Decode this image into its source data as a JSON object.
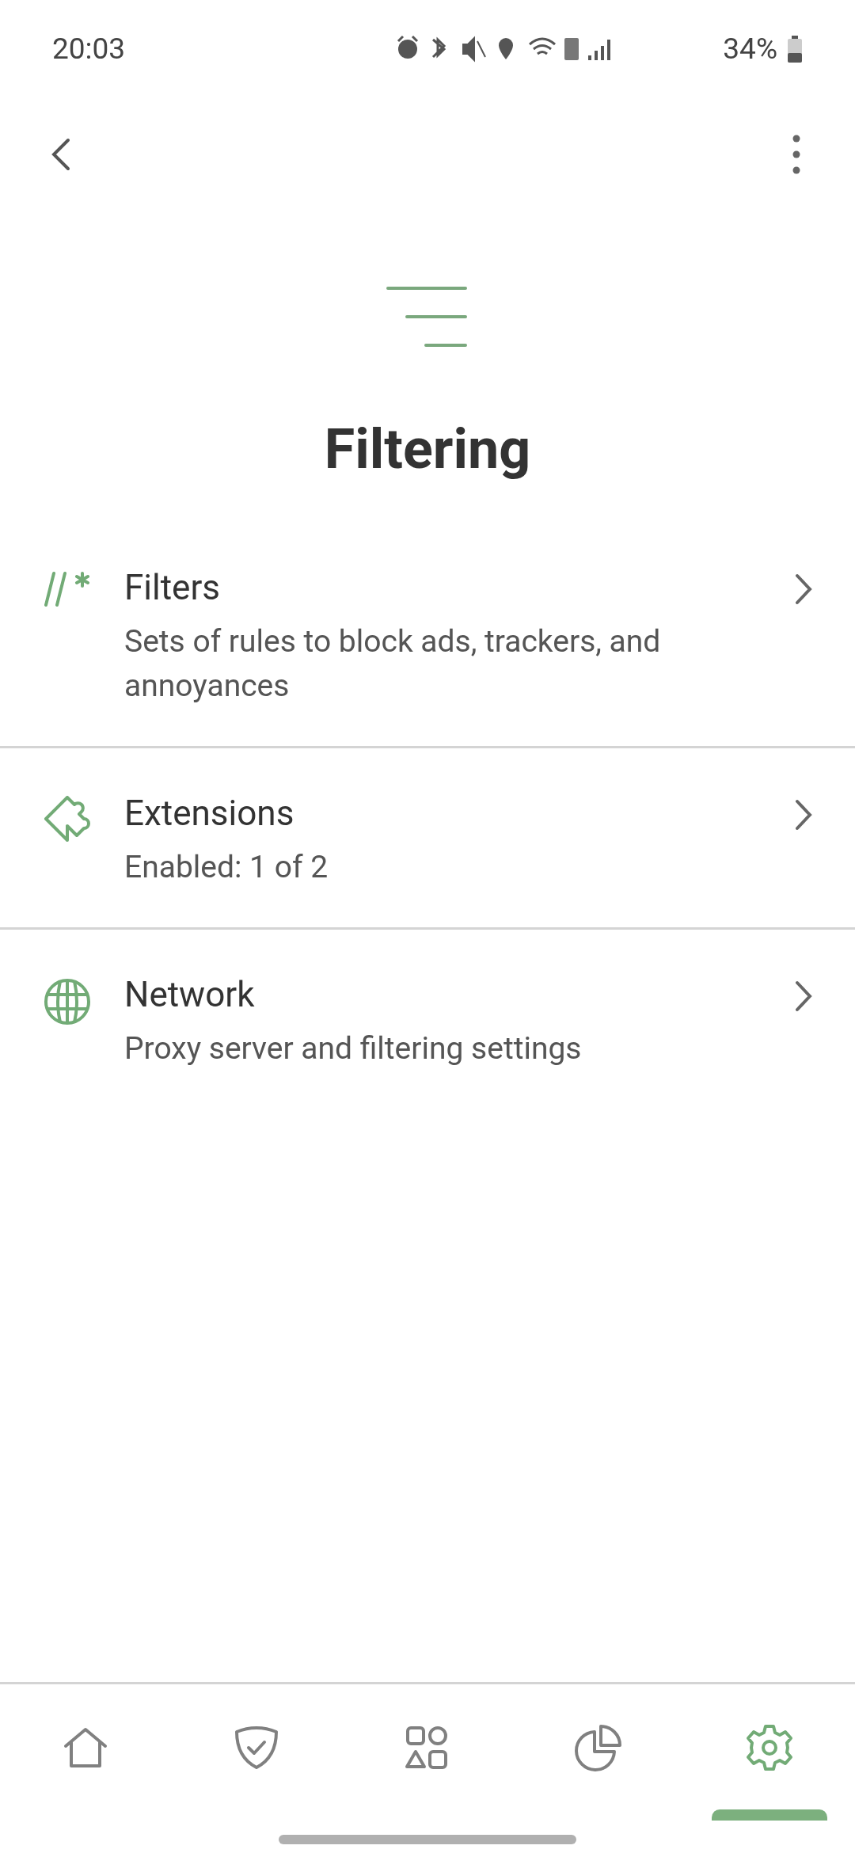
{
  "status_bar": {
    "time": "20:03",
    "battery": "34%"
  },
  "title": "Filtering",
  "items": [
    {
      "kind": "filters",
      "title": "Filters",
      "subtitle": "Sets of rules to block ads, trackers, and annoyances"
    },
    {
      "kind": "extensions",
      "title": "Extensions",
      "subtitle": "Enabled: 1 of 2"
    },
    {
      "kind": "network",
      "title": "Network",
      "subtitle": "Proxy server and filtering settings"
    }
  ],
  "nav": [
    {
      "kind": "home",
      "selected": false
    },
    {
      "kind": "protection",
      "selected": false
    },
    {
      "kind": "apps",
      "selected": false
    },
    {
      "kind": "stats",
      "selected": false
    },
    {
      "kind": "settings",
      "selected": true
    }
  ]
}
